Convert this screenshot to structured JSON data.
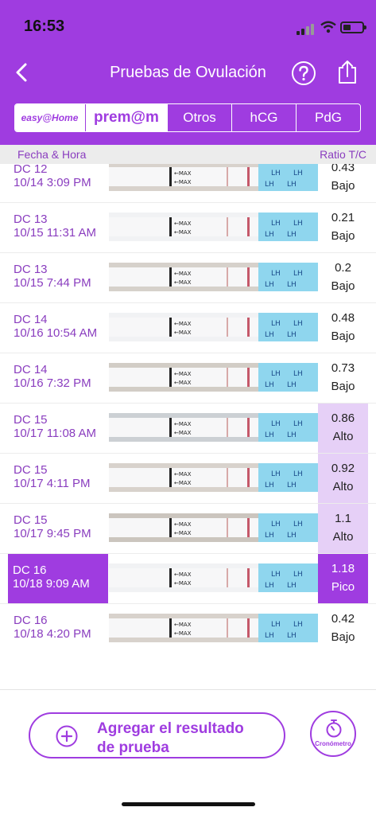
{
  "status_bar": {
    "time": "16:53"
  },
  "nav": {
    "title": "Pruebas de Ovulación"
  },
  "tabs": [
    {
      "label": "easy@Home"
    },
    {
      "label": "prem@m"
    },
    {
      "label": "Otros"
    },
    {
      "label": "hCG"
    },
    {
      "label": "PdG"
    }
  ],
  "columns": {
    "left": "Fecha & Hora",
    "right": "Ratio T/C"
  },
  "rows": [
    {
      "dc": "DC 12",
      "datetime": "10/14 3:09 PM",
      "ratio": "0.43",
      "level": "Bajo",
      "status": "bajo"
    },
    {
      "dc": "DC 13",
      "datetime": "10/15 11:31 AM",
      "ratio": "0.21",
      "level": "Bajo",
      "status": "bajo"
    },
    {
      "dc": "DC 13",
      "datetime": "10/15 7:44 PM",
      "ratio": "0.2",
      "level": "Bajo",
      "status": "bajo"
    },
    {
      "dc": "DC 14",
      "datetime": "10/16 10:54 AM",
      "ratio": "0.48",
      "level": "Bajo",
      "status": "bajo"
    },
    {
      "dc": "DC 14",
      "datetime": "10/16 7:32 PM",
      "ratio": "0.73",
      "level": "Bajo",
      "status": "bajo"
    },
    {
      "dc": "DC 15",
      "datetime": "10/17 11:08 AM",
      "ratio": "0.86",
      "level": "Alto",
      "status": "alto"
    },
    {
      "dc": "DC 15",
      "datetime": "10/17 4:11 PM",
      "ratio": "0.92",
      "level": "Alto",
      "status": "alto"
    },
    {
      "dc": "DC 15",
      "datetime": "10/17 9:45 PM",
      "ratio": "1.1",
      "level": "Alto",
      "status": "alto"
    },
    {
      "dc": "DC 16",
      "datetime": "10/18 9:09 AM",
      "ratio": "1.18",
      "level": "Pico",
      "status": "pico",
      "selected": true
    },
    {
      "dc": "DC 16",
      "datetime": "10/18 4:20 PM",
      "ratio": "0.42",
      "level": "Bajo",
      "status": "bajo"
    }
  ],
  "strip": {
    "max_label": "MAX",
    "lh_label": "LH",
    "tint": [
      "#d8d2cc",
      "#f1f2f4",
      "#d6d1cb",
      "#f1f2f4",
      "#d2cdc6",
      "#ccd0d4",
      "#d8d2cc",
      "#cbc5be",
      "#f1f2f4",
      "#d8d2cc"
    ]
  },
  "actions": {
    "add_result": "Agregar el resultado de prueba",
    "add_result_line1": "Agregar el resultado",
    "add_result_line2": "de prueba",
    "timer": "Cronómetro"
  },
  "colors": {
    "primary": "#9f3ce0",
    "alto_bg": "#e6d0f7",
    "strip_blue": "#8fd6ee"
  }
}
